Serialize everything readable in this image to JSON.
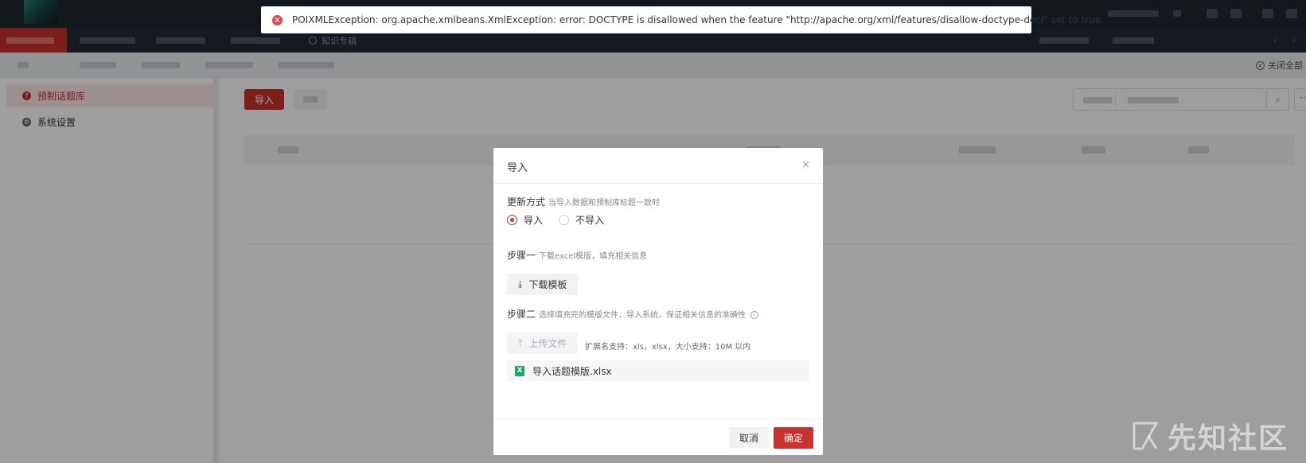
{
  "toast": {
    "message": "POIXMLException: org.apache.xmlbeans.XmlException: error: DOCTYPE is disallowed when the feature \"http://apache.org/xml/features/disallow-doctype-decl\" set to true.",
    "icon": "error-circle-icon",
    "color": "#e5484d"
  },
  "nav": {
    "visible_item": "知识专辑"
  },
  "tabs": {
    "close_all": "关闭全部"
  },
  "sidebar": {
    "items": [
      {
        "label": "预制话题库",
        "icon": "question-circle-icon",
        "active": true
      },
      {
        "label": "系统设置",
        "icon": "gear-icon",
        "active": false
      }
    ]
  },
  "toolbar": {
    "import_label": "导入"
  },
  "dialog": {
    "title": "导入",
    "update_mode_label": "更新方式",
    "update_mode_hint": "当导入数据和预制库标题一致时",
    "radio_options": [
      "导入",
      "不导入"
    ],
    "selected_option": "导入",
    "step1_label": "步骤一",
    "step1_hint": "下载excel模版，填充相关信息",
    "download_button": "下载模板",
    "step2_label": "步骤二",
    "step2_hint": "选择填充完的模版文件，导入系统，保证相关信息的准确性",
    "upload_button": "上传文件",
    "upload_hint": "扩展名支持：xls，xlsx，大小支持：10M 以内",
    "file_name": "导入话题模版.xlsx",
    "cancel_button": "取消",
    "ok_button": "确定"
  },
  "watermark": {
    "text": "先知社区"
  },
  "colors": {
    "accent": "#c8332d",
    "topbar": "#1f2730",
    "excel": "#21a366"
  }
}
